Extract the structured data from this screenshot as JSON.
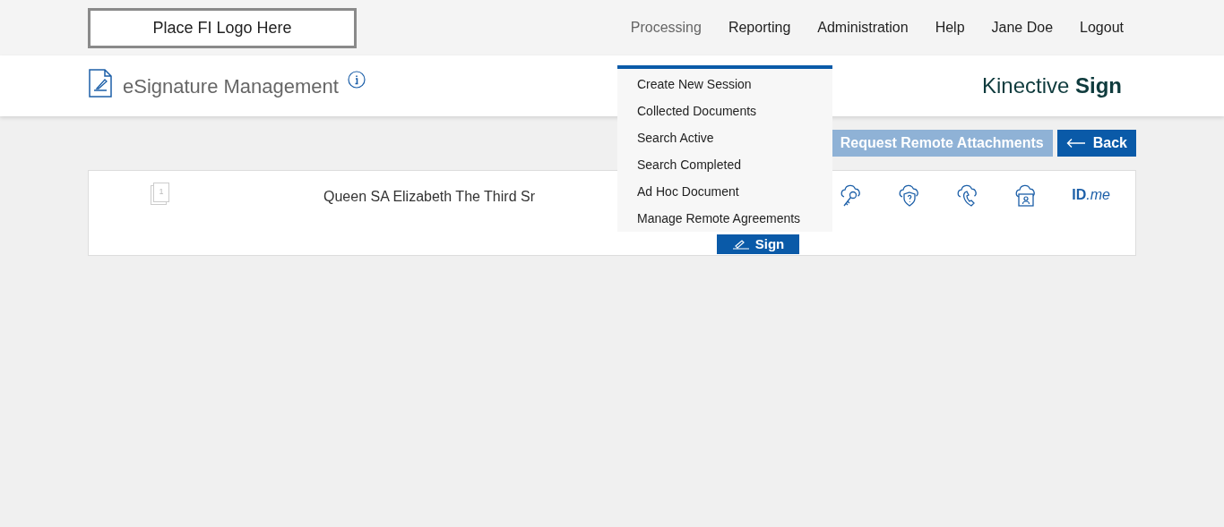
{
  "header": {
    "logo_placeholder": "Place FI Logo Here",
    "nav": [
      {
        "label": "Processing",
        "selected": true
      },
      {
        "label": "Reporting",
        "selected": false
      },
      {
        "label": "Administration",
        "selected": false
      },
      {
        "label": "Help",
        "selected": false
      },
      {
        "label": "Jane Doe",
        "selected": false
      },
      {
        "label": "Logout",
        "selected": false
      }
    ]
  },
  "page_title": "eSignature Management",
  "brand": {
    "light": "Kinective",
    "bold": "Sign"
  },
  "dropdown": [
    "Create New Session",
    "Collected Documents",
    "Search Active",
    "Search Completed",
    "Ad Hoc Document",
    "Manage Remote Agreements"
  ],
  "toolbar": {
    "request_button": {
      "label": "Request Remote Attachments",
      "disabled": true
    },
    "back_button": {
      "label": "Back"
    }
  },
  "row": {
    "page_count": "1",
    "name": "Queen SA Elizabeth The Third Sr",
    "sign_button": "Sign",
    "idme": {
      "main": "ID",
      "suffix": ".me"
    }
  }
}
